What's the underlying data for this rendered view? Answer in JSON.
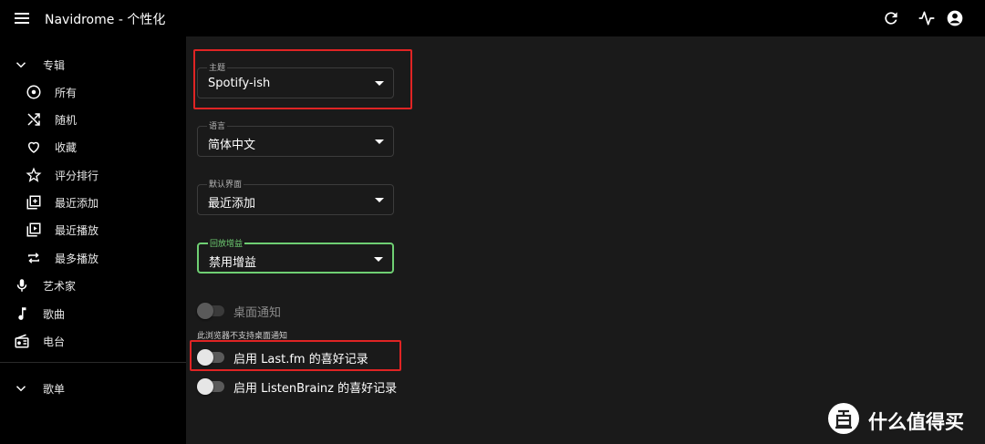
{
  "app": {
    "title": "Navidrome - 个性化"
  },
  "topbar_icons": [
    "menu-icon",
    "refresh-icon",
    "activity-icon",
    "account-icon"
  ],
  "sidebar": {
    "sections": [
      {
        "label": "专辑",
        "icon": "chevron-down-icon",
        "items": [
          {
            "label": "所有",
            "icon": "album-icon"
          },
          {
            "label": "随机",
            "icon": "shuffle-icon"
          },
          {
            "label": "收藏",
            "icon": "heart-icon"
          },
          {
            "label": "评分排行",
            "icon": "star-icon"
          },
          {
            "label": "最近添加",
            "icon": "library-add-icon"
          },
          {
            "label": "最近播放",
            "icon": "video-library-icon"
          },
          {
            "label": "最多播放",
            "icon": "repeat-icon"
          }
        ]
      },
      {
        "label": "艺术家",
        "icon": "mic-icon"
      },
      {
        "label": "歌曲",
        "icon": "music-note-icon"
      },
      {
        "label": "电台",
        "icon": "radio-icon"
      },
      {
        "label": "歌单",
        "icon": "chevron-down-icon"
      }
    ]
  },
  "settings": {
    "theme": {
      "label": "主题",
      "value": "Spotify-ish"
    },
    "language": {
      "label": "语言",
      "value": "简体中文"
    },
    "default_view": {
      "label": "默认界面",
      "value": "最近添加"
    },
    "replay_gain": {
      "label": "回放增益",
      "value": "禁用增益"
    },
    "desktop_notify": {
      "label": "桌面通知",
      "helper": "此浏览器不支持桌面通知",
      "enabled": false,
      "disabled": true
    },
    "lastfm": {
      "label": "启用 Last.fm 的喜好记录",
      "enabled": false
    },
    "listenbrainz": {
      "label": "启用 ListenBrainz 的喜好记录",
      "enabled": false
    }
  },
  "watermark": {
    "text": "什么值得买",
    "badge": "值"
  },
  "colors": {
    "active_field": "#6fcf73",
    "highlight": "#e02424",
    "background": "#1a1a1a"
  }
}
